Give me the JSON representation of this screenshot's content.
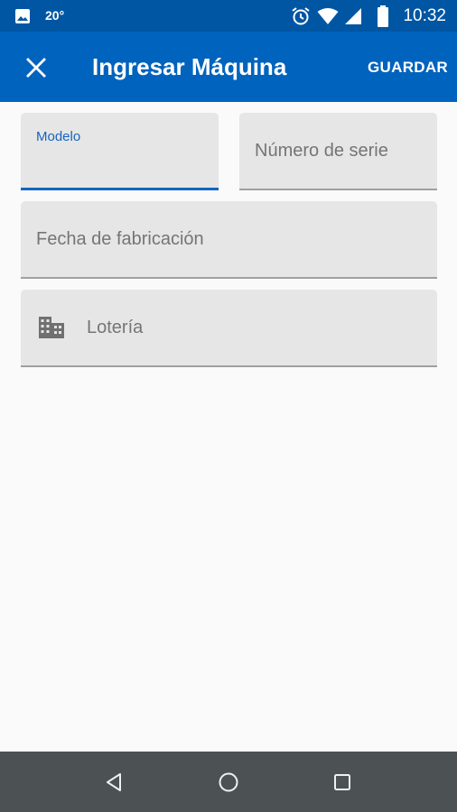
{
  "status_bar": {
    "temperature": "20°",
    "time": "10:32",
    "icons": [
      "image-icon",
      "alarm-icon",
      "wifi-icon",
      "signal-icon",
      "battery-icon"
    ]
  },
  "app_bar": {
    "title": "Ingresar Máquina",
    "save_label": "GUARDAR",
    "close_icon": "close-icon",
    "background": "#0063bd"
  },
  "form": {
    "modelo": {
      "label": "Modelo",
      "value": ""
    },
    "numero_serie": {
      "placeholder": "Número de serie",
      "value": ""
    },
    "fecha_fabricacion": {
      "placeholder": "Fecha de fabricación",
      "value": ""
    },
    "loteria": {
      "placeholder": "Lotería",
      "icon": "building-icon",
      "value": ""
    }
  },
  "nav_bar": {
    "icons": [
      "back-icon",
      "home-icon",
      "recents-icon"
    ]
  },
  "colors": {
    "status_bar": "#0056a3",
    "app_bar": "#0063bd",
    "accent": "#1565c0",
    "field_bg": "#e6e6e6",
    "nav_bar": "#4c5254"
  }
}
